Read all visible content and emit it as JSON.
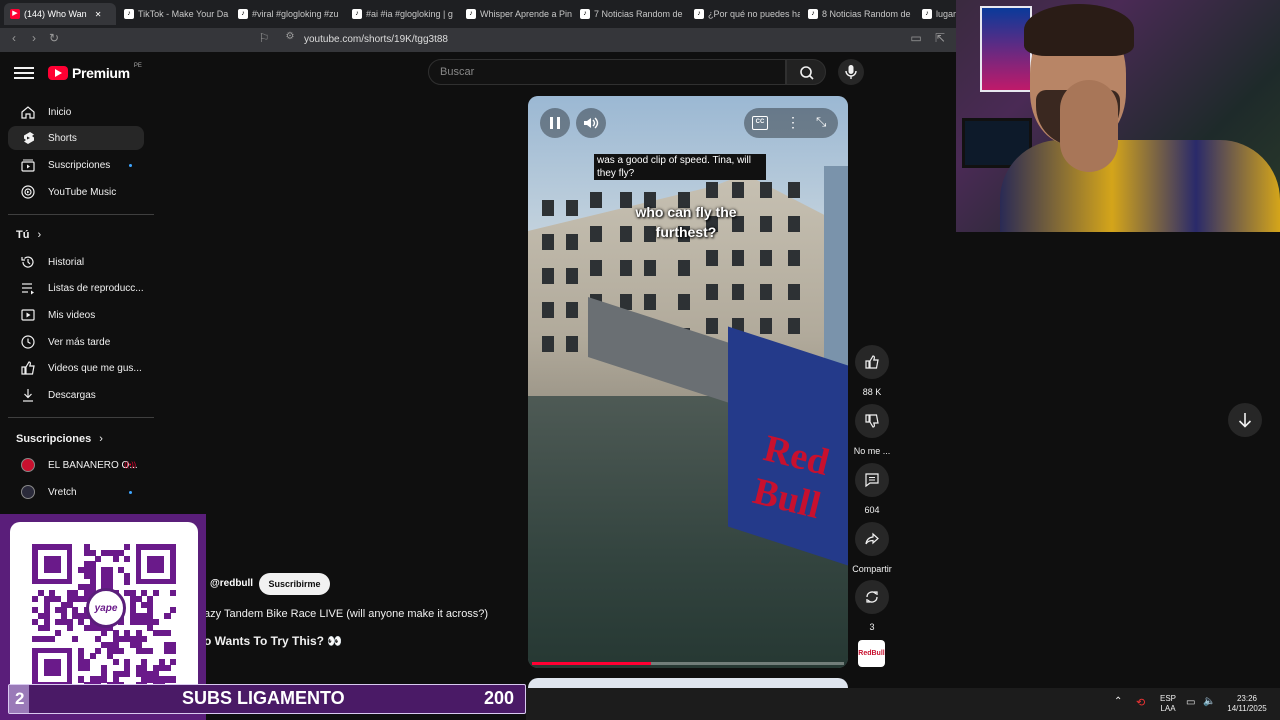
{
  "browser": {
    "tabs": [
      {
        "label": "(144) Who Wan",
        "icon": "youtube-icon",
        "active": true
      },
      {
        "label": "TikTok - Make Your Da",
        "icon": "tiktok-icon"
      },
      {
        "label": "#viral #glogloking #zu",
        "icon": "tiktok-icon"
      },
      {
        "label": "#ai #ia #glogloking | g",
        "icon": "tiktok-icon"
      },
      {
        "label": "Whisper Aprende a Pin",
        "icon": "tiktok-icon"
      },
      {
        "label": "7 Noticias Random de",
        "icon": "tiktok-icon"
      },
      {
        "label": "¿Por qué no puedes ha",
        "icon": "tiktok-icon"
      },
      {
        "label": "8 Noticias Random de",
        "icon": "tiktok-icon"
      },
      {
        "label": "lugar",
        "icon": "tiktok-icon"
      }
    ],
    "url": "youtube.com/shorts/19K/tgg3t88"
  },
  "youtube": {
    "logo_text": "Premium",
    "country_code": "PE",
    "search_placeholder": "Buscar"
  },
  "sidebar": {
    "main": [
      {
        "label": "Inicio",
        "icon": "home-icon"
      },
      {
        "label": "Shorts",
        "icon": "shorts-icon",
        "active": true
      },
      {
        "label": "Suscripciones",
        "icon": "subscriptions-icon",
        "dot": true
      },
      {
        "label": "YouTube Music",
        "icon": "music-icon"
      }
    ],
    "you_heading": "Tú",
    "you": [
      {
        "label": "Historial",
        "icon": "history-icon"
      },
      {
        "label": "Listas de reproducc...",
        "icon": "playlist-icon"
      },
      {
        "label": "Mis videos",
        "icon": "my-videos-icon"
      },
      {
        "label": "Ver más tarde",
        "icon": "clock-icon"
      },
      {
        "label": "Videos que me gus...",
        "icon": "thumbs-up-icon"
      },
      {
        "label": "Descargas",
        "icon": "download-icon"
      }
    ],
    "subs_heading": "Suscripciones",
    "subs": [
      {
        "label": "EL BANANERO O...",
        "live": true
      },
      {
        "label": "Vretch",
        "dot": true
      }
    ]
  },
  "video": {
    "caption_top": "was a good clip of speed. Tina, will they fly?",
    "caption_main": "who can fly the furthest?",
    "brand_on_ramp": "Red Bull",
    "progress_fraction": 0.38,
    "channel_handle": "@redbull",
    "subscribe_label": "Suscribirme",
    "title_line": "azy Tandem Bike Race LIVE (will anyone make it across?)",
    "title_line2": "o Wants To Try This? 👀",
    "channel_thumb_text": "RedBull"
  },
  "actions": {
    "like_count": "88 K",
    "dislike_label": "No me ...",
    "comments_count": "604",
    "share_label": "Compartir",
    "remix_count": "3"
  },
  "overlay": {
    "qr_brand": "yape",
    "subs_count": "2",
    "subs_title": "SUBS LIGAMENTO",
    "subs_goal": "200",
    "subs_progress_fraction": 0.01
  },
  "taskbar": {
    "lang_top": "ESP",
    "lang_bottom": "LAA",
    "time": "23:26",
    "date": "14/11/2025"
  },
  "colors": {
    "yt_red": "#ff0033",
    "bg": "#0f0f0f",
    "redbull_red": "#c8102e",
    "overlay_purple": "#5a1e7a"
  }
}
